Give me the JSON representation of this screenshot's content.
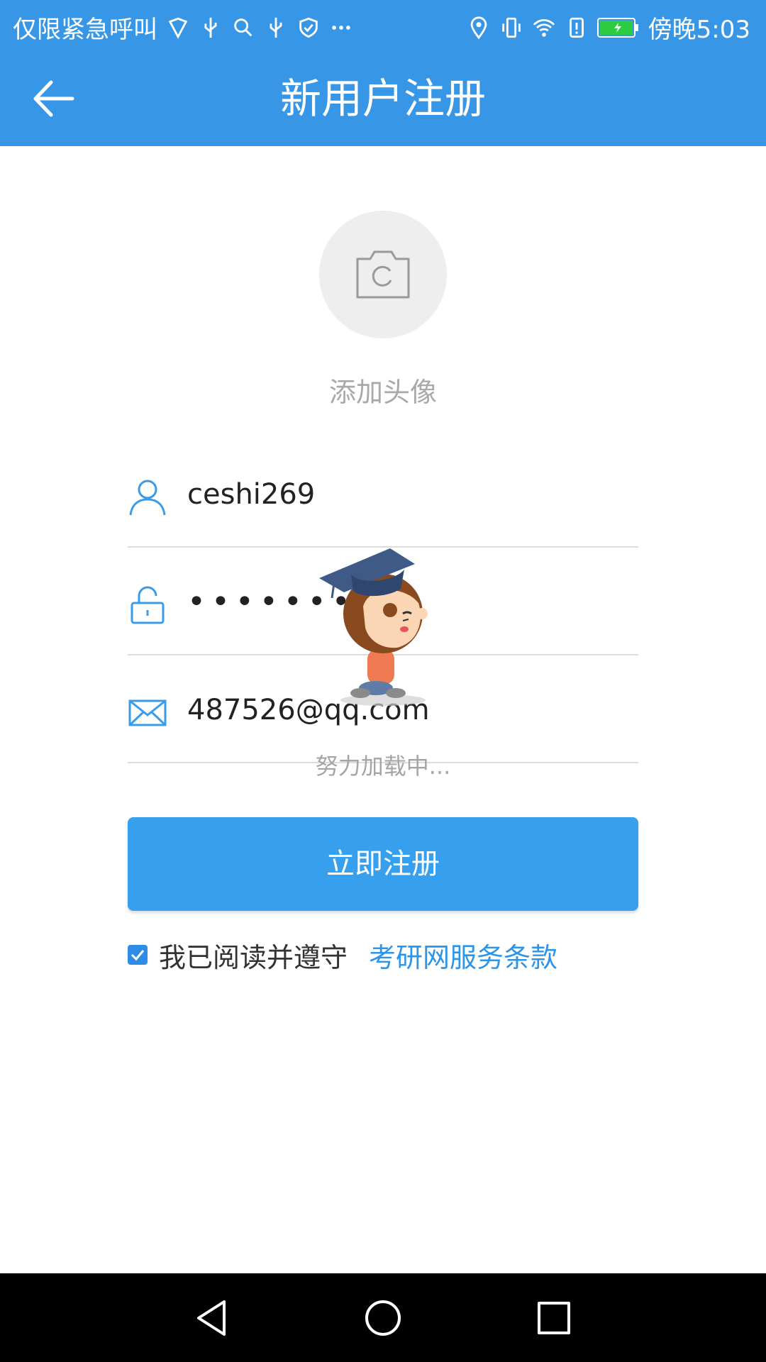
{
  "status_bar": {
    "carrier_text": "仅限紧急呼叫",
    "time": "傍晚5:03",
    "icons_left": [
      "shield-icon",
      "usb-icon",
      "search-icon",
      "usb-icon",
      "shield-check-icon",
      "more-icon"
    ],
    "icons_right": [
      "location-icon",
      "vibrate-icon",
      "wifi-icon",
      "alert-icon",
      "battery-icon"
    ]
  },
  "header": {
    "title": "新用户注册",
    "back_icon": "arrow-left-icon",
    "background": "#3796e6"
  },
  "avatar": {
    "icon": "camera-icon",
    "label": "添加头像"
  },
  "form": {
    "username": {
      "icon": "user-icon",
      "value": "ceshi269"
    },
    "password": {
      "icon": "lock-icon",
      "value": "••••••••"
    },
    "email": {
      "icon": "mail-icon",
      "value": "487526@qq.com"
    }
  },
  "loading": {
    "text": "努力加载中..."
  },
  "register_button": {
    "label": "立即注册",
    "color": "#36a0ee"
  },
  "agreement": {
    "checked": true,
    "text": "我已阅读并遵守",
    "link_text": "考研网服务条款",
    "link_color": "#2e94e8"
  },
  "nav_bar": {
    "buttons": [
      "back-triangle-icon",
      "home-circle-icon",
      "recents-square-icon"
    ]
  }
}
